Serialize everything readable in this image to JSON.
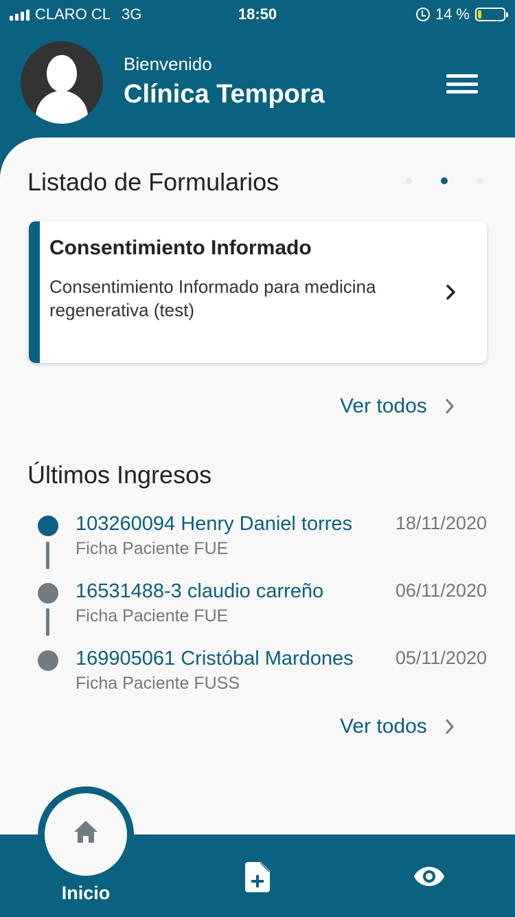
{
  "status_bar": {
    "carrier": "CLARO CL",
    "network": "3G",
    "time": "18:50",
    "battery": "14 %",
    "battery_level": 0.14
  },
  "header": {
    "welcome": "Bienvenido",
    "clinic_name": "Clínica Tempora"
  },
  "forms": {
    "title": "Listado de Formularios",
    "carousel_pages": 3,
    "carousel_active": 1,
    "card": {
      "title": "Consentimiento Informado",
      "description": "Consentimiento Informado para medicina regenerativa (test)"
    },
    "see_all": "Ver todos"
  },
  "recent": {
    "title": "Últimos Ingresos",
    "items": [
      {
        "name": "103260094 Henry Daniel torres",
        "date": "18/11/2020",
        "form": "Ficha Paciente FUE"
      },
      {
        "name": "16531488-3 claudio carreño",
        "date": "06/11/2020",
        "form": "Ficha Paciente FUE"
      },
      {
        "name": "169905061 Cristóbal Mardones",
        "date": "05/11/2020",
        "form": "Ficha Paciente FUSS"
      }
    ],
    "see_all": "Ver todos"
  },
  "tabbar": {
    "home_label": "Inicio",
    "icons": [
      "home-icon",
      "add-document-icon",
      "eye-icon"
    ]
  },
  "colors": {
    "primary": "#0a6180",
    "inactive_dot": "#737b80",
    "background": "#f8f8f8"
  }
}
